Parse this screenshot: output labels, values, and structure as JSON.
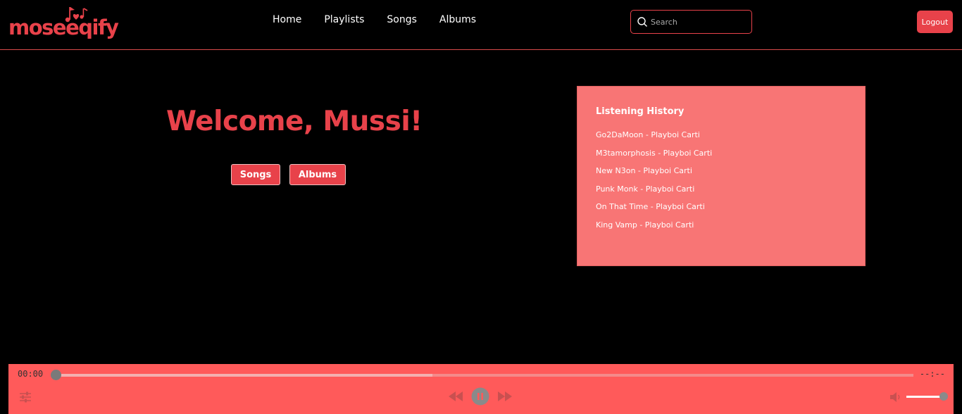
{
  "header": {
    "logo_text": "moseeqify",
    "nav": [
      {
        "label": "Home"
      },
      {
        "label": "Playlists"
      },
      {
        "label": "Songs"
      },
      {
        "label": "Albums"
      }
    ],
    "search": {
      "placeholder": "Search",
      "value": ""
    },
    "logout_label": "Logout",
    "accent_color": "#e8424a"
  },
  "main": {
    "welcome": "Welcome, Mussi!",
    "songs_button": "Songs",
    "albums_button": "Albums"
  },
  "history": {
    "title": "Listening History",
    "items": [
      {
        "label": "Go2DaMoon - Playboi Carti"
      },
      {
        "label": "M3tamorphosis - Playboi Carti"
      },
      {
        "label": "New N3on - Playboi Carti"
      },
      {
        "label": "Punk Monk - Playboi Carti"
      },
      {
        "label": "On That Time - Playboi Carti"
      },
      {
        "label": "King Vamp - Playboi Carti"
      }
    ],
    "panel_color": "#f87575"
  },
  "player": {
    "current_time": "00:00",
    "duration": "--:--",
    "progress": 0,
    "buffered": 0.44,
    "volume": 0.95,
    "state": "playing",
    "icons": [
      "equalizer-icon",
      "rewind-icon",
      "pause-icon",
      "fast-forward-icon",
      "volume-icon"
    ],
    "bar_color": "#ff5a5a"
  }
}
